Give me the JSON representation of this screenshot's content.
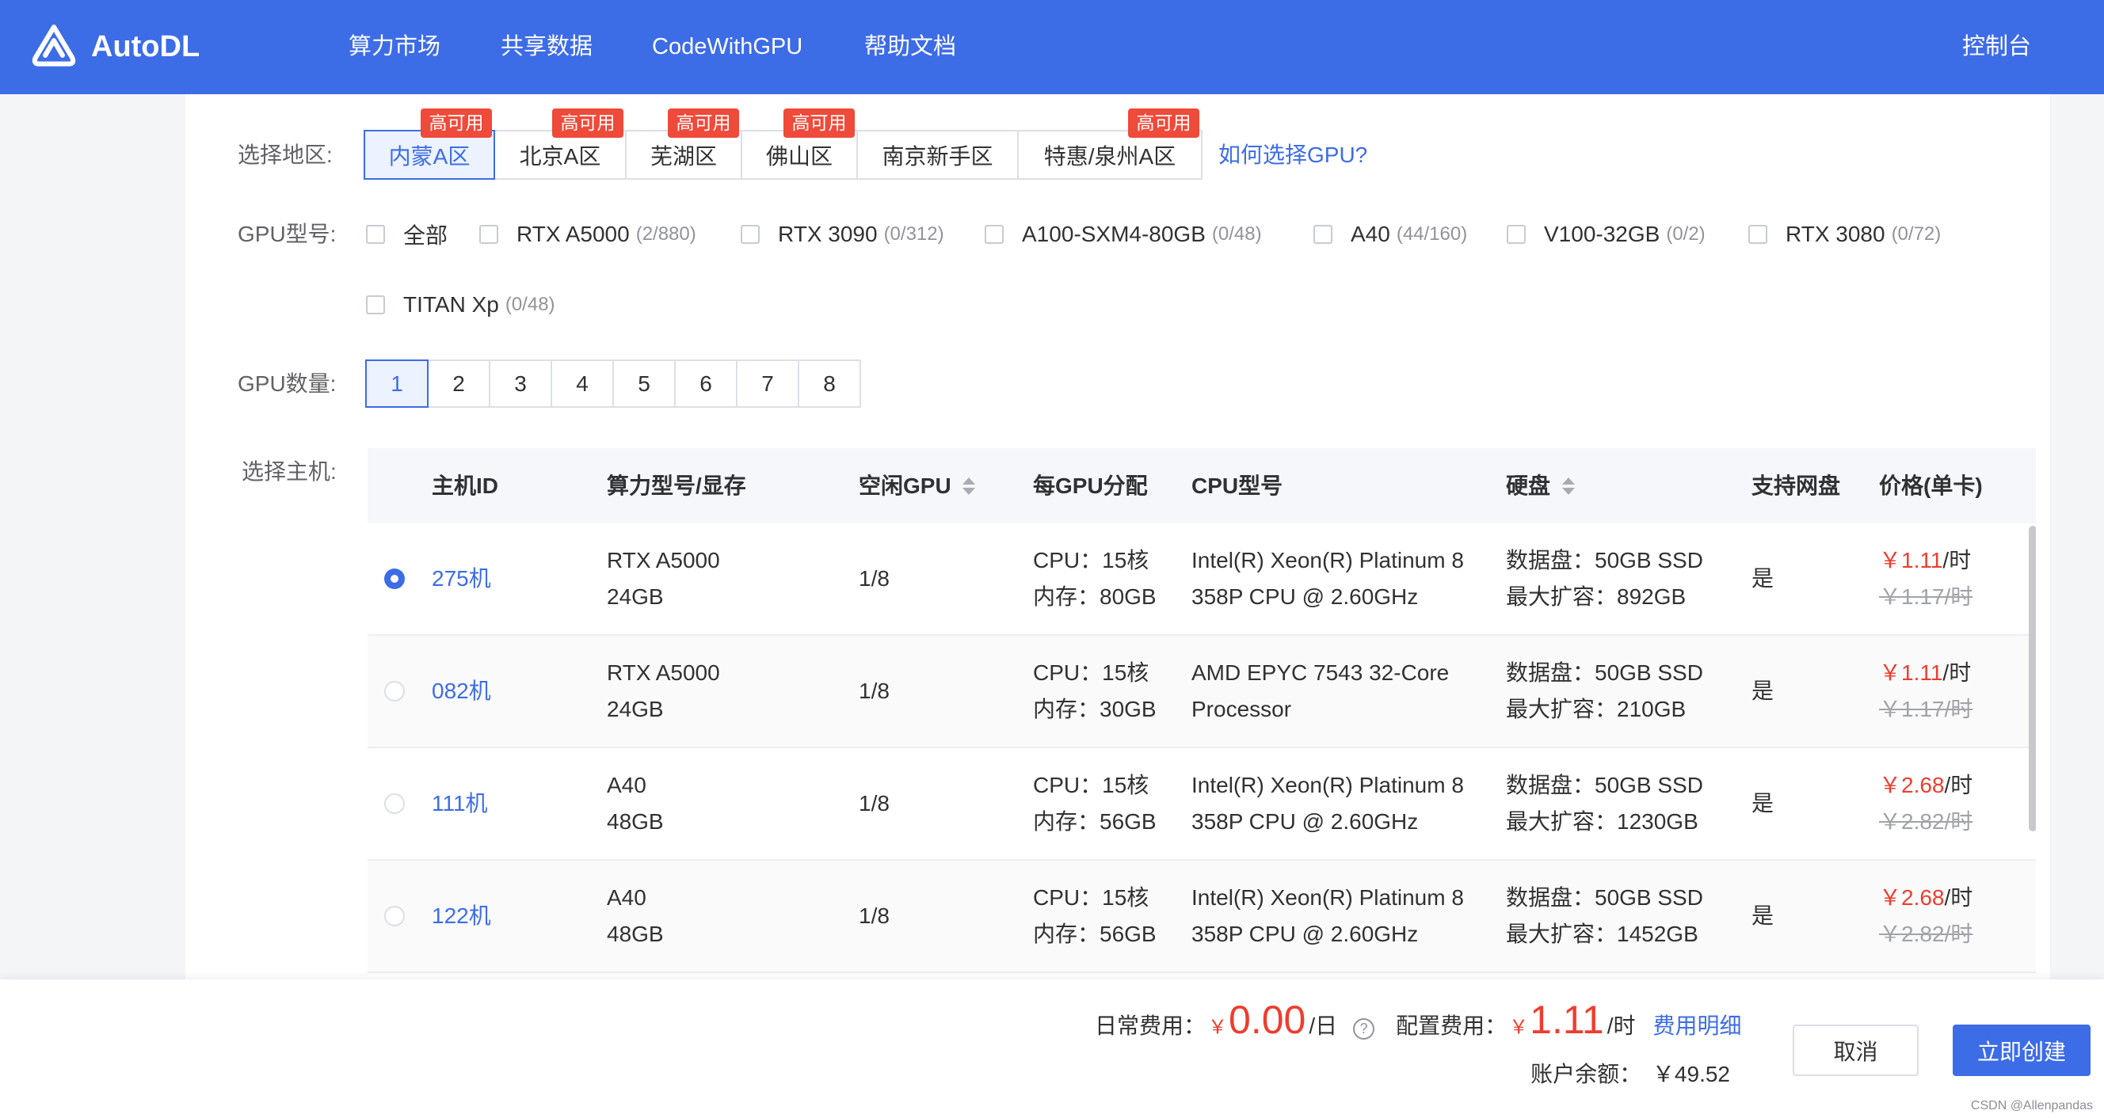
{
  "header": {
    "logo_text": "AutoDL",
    "logo_icon": "autodl-logo-icon",
    "nav": [
      {
        "label": "算力市场"
      },
      {
        "label": "共享数据"
      },
      {
        "label": "CodeWithGPU"
      },
      {
        "label": "帮助文档"
      }
    ],
    "console": "控制台"
  },
  "region": {
    "label": "选择地区:",
    "tabs": [
      {
        "label": "内蒙A区",
        "badge": "高可用",
        "selected": true
      },
      {
        "label": "北京A区",
        "badge": "高可用",
        "selected": false
      },
      {
        "label": "芜湖区",
        "badge": "高可用",
        "selected": false
      },
      {
        "label": "佛山区",
        "badge": "高可用",
        "selected": false
      },
      {
        "label": "南京新手区",
        "selected": false
      },
      {
        "label": "特惠/泉州A区",
        "badge": "高可用",
        "selected": false
      }
    ],
    "help_link": "如何选择GPU?"
  },
  "gpu_model": {
    "label": "GPU型号:",
    "options": [
      {
        "name": "全部",
        "checked": false
      },
      {
        "name": "RTX A5000",
        "count": "(2/880)",
        "checked": false
      },
      {
        "name": "RTX 3090",
        "count": "(0/312)",
        "checked": false
      },
      {
        "name": "A100-SXM4-80GB",
        "count": "(0/48)",
        "checked": false
      },
      {
        "name": "A40",
        "count": "(44/160)",
        "checked": false
      },
      {
        "name": "V100-32GB",
        "count": "(0/2)",
        "checked": false
      },
      {
        "name": "RTX 3080",
        "count": "(0/72)",
        "checked": false
      },
      {
        "name": "TITAN Xp",
        "count": "(0/48)",
        "checked": false
      }
    ]
  },
  "gpu_count": {
    "label": "GPU数量:",
    "options": [
      "1",
      "2",
      "3",
      "4",
      "5",
      "6",
      "7",
      "8"
    ],
    "selected": "1"
  },
  "host": {
    "label": "选择主机:",
    "columns": [
      "主机ID",
      "算力型号/显存",
      "空闲GPU",
      "每GPU分配",
      "CPU型号",
      "硬盘",
      "支持网盘",
      "价格(单卡)"
    ],
    "sortable_columns": [
      "空闲GPU",
      "硬盘"
    ],
    "rows": [
      {
        "id": "275机",
        "gpu": "RTX A5000",
        "vram": "24GB",
        "free": "1/8",
        "cpu": "CPU：15核",
        "mem": "内存：80GB",
        "cpu_model_1": "Intel(R) Xeon(R) Platinum 8",
        "cpu_model_2": "358P CPU @ 2.60GHz",
        "disk": "数据盘：50GB SSD",
        "disk_max": "最大扩容：892GB",
        "netdisk": "是",
        "price": "￥1.11",
        "price_unit": "/时",
        "orig_price": "￥1.17/时",
        "selected": true
      },
      {
        "id": "082机",
        "gpu": "RTX A5000",
        "vram": "24GB",
        "free": "1/8",
        "cpu": "CPU：15核",
        "mem": "内存：30GB",
        "cpu_model_1": "AMD EPYC 7543 32-Core",
        "cpu_model_2": "Processor",
        "disk": "数据盘：50GB SSD",
        "disk_max": "最大扩容：210GB",
        "netdisk": "是",
        "price": "￥1.11",
        "price_unit": "/时",
        "orig_price": "￥1.17/时",
        "selected": false
      },
      {
        "id": "111机",
        "gpu": "A40",
        "vram": "48GB",
        "free": "1/8",
        "cpu": "CPU：15核",
        "mem": "内存：56GB",
        "cpu_model_1": "Intel(R) Xeon(R) Platinum 8",
        "cpu_model_2": "358P CPU @ 2.60GHz",
        "disk": "数据盘：50GB SSD",
        "disk_max": "最大扩容：1230GB",
        "netdisk": "是",
        "price": "￥2.68",
        "price_unit": "/时",
        "orig_price": "￥2.82/时",
        "selected": false
      },
      {
        "id": "122机",
        "gpu": "A40",
        "vram": "48GB",
        "free": "1/8",
        "cpu": "CPU：15核",
        "mem": "内存：56GB",
        "cpu_model_1": "Intel(R) Xeon(R) Platinum 8",
        "cpu_model_2": "358P CPU @ 2.60GHz",
        "disk": "数据盘：50GB SSD",
        "disk_max": "最大扩容：1452GB",
        "netdisk": "是",
        "price": "￥2.68",
        "price_unit": "/时",
        "orig_price": "￥2.82/时",
        "selected": false
      }
    ]
  },
  "footer": {
    "daily_label": "日常费用：",
    "daily_currency": "￥",
    "daily_amount": "0.00",
    "daily_unit": "/日",
    "help_icon": "?",
    "config_label": "配置费用：",
    "config_currency": "￥",
    "config_amount": "1.11",
    "config_unit": "/时",
    "detail_link": "费用明细",
    "balance_label": "账户余额：",
    "balance_value": "￥49.52",
    "cancel": "取消",
    "create": "立即创建"
  },
  "watermark": "CSDN @Allenpandas",
  "colors": {
    "header_bg": "#3d6ce7",
    "accent": "#3d6ce7",
    "price_red": "#ee3d2f",
    "badge_red": "#ef4a3a",
    "selected_bg": "#ecf2ff"
  },
  "icons": {
    "sort": "sort-caret-icon",
    "help": "question-circle-icon",
    "radio": "radio-icon",
    "checkbox": "checkbox-icon"
  }
}
